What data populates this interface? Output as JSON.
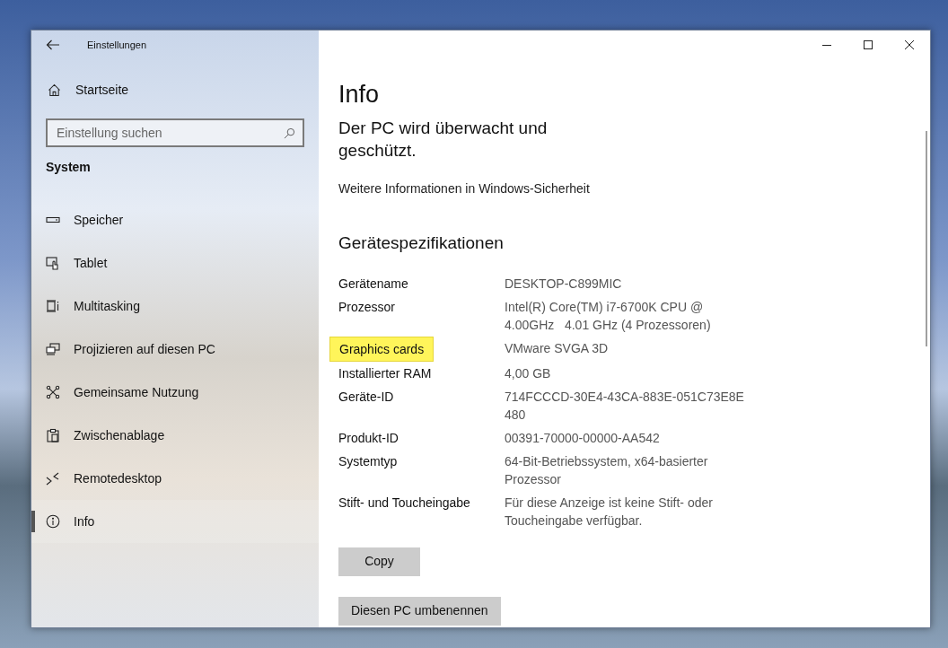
{
  "window": {
    "title": "Einstellungen"
  },
  "sidebar": {
    "home": "Startseite",
    "search": {
      "placeholder": "Einstellung suchen"
    },
    "section": "System",
    "items": [
      {
        "label": "Speicher",
        "kind": "storage",
        "selected": false
      },
      {
        "label": "Tablet",
        "kind": "tablet",
        "selected": false
      },
      {
        "label": "Multitasking",
        "kind": "multitask",
        "selected": false
      },
      {
        "label": "Projizieren auf diesen PC",
        "kind": "project",
        "selected": false
      },
      {
        "label": "Gemeinsame Nutzung",
        "kind": "share",
        "selected": false
      },
      {
        "label": "Zwischenablage",
        "kind": "clipboard",
        "selected": false
      },
      {
        "label": "Remotedesktop",
        "kind": "remote",
        "selected": false
      },
      {
        "label": "Info",
        "kind": "info",
        "selected": true
      }
    ]
  },
  "content": {
    "title": "Info",
    "status_heading": "Der PC wird überwacht und geschützt.",
    "security_link": "Weitere Informationen in Windows-Sicherheit",
    "specs_heading": "Gerätespezifikationen",
    "specs": [
      {
        "label": "Gerätename",
        "value": [
          "DESKTOP-C899MIC"
        ],
        "highlighted": false
      },
      {
        "label": "Prozessor",
        "value": [
          "Intel(R) Core(TM) i7-6700K CPU @",
          "4.00GHz   4.01 GHz (4 Prozessoren)"
        ],
        "highlighted": false
      },
      {
        "label": "Graphics cards",
        "value": [
          "VMware SVGA 3D"
        ],
        "highlighted": true
      },
      {
        "label": "Installierter RAM",
        "value": [
          "4,00 GB"
        ],
        "highlighted": false
      },
      {
        "label": "Geräte-ID",
        "value": [
          "714FCCCD-30E4-43CA-883E-051C73E8E",
          "480"
        ],
        "highlighted": false
      },
      {
        "label": "Produkt-ID",
        "value": [
          "00391-70000-00000-AA542"
        ],
        "highlighted": false
      },
      {
        "label": "Systemtyp",
        "value": [
          "64-Bit-Betriebssystem, x64-basierter",
          "Prozessor"
        ],
        "highlighted": false
      },
      {
        "label": "Stift- und Toucheingabe",
        "value": [
          "Für diese Anzeige ist keine Stift- oder",
          "Toucheingabe verfügbar."
        ],
        "highlighted": false
      }
    ],
    "buttons": [
      "Copy",
      "Diesen PC umbenennen"
    ]
  }
}
